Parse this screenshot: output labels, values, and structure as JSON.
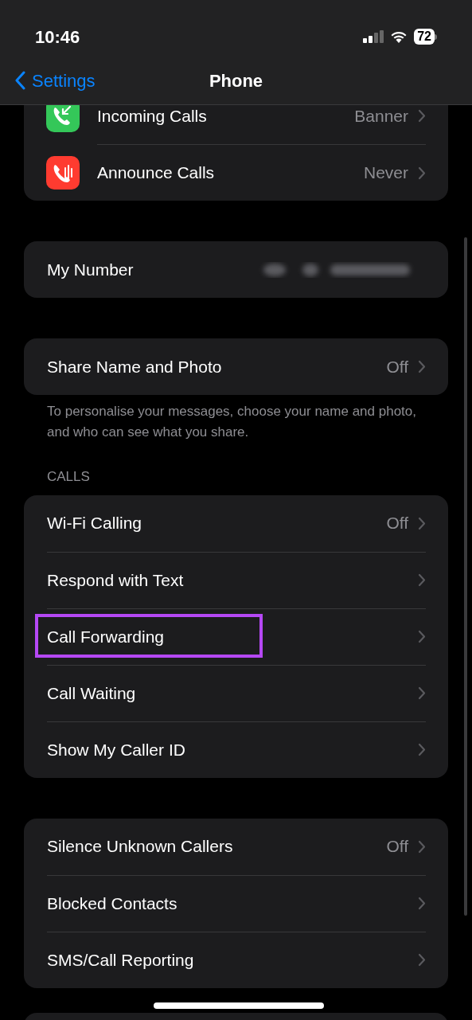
{
  "status_bar": {
    "time": "10:46",
    "battery": "72"
  },
  "nav": {
    "back": "Settings",
    "title": "Phone"
  },
  "groups": [
    {
      "rows": [
        {
          "kind": "icon",
          "label": "Incoming Calls",
          "value": "Banner",
          "color": "#34c759",
          "highlighted": false
        },
        {
          "kind": "icon",
          "label": "Announce Calls",
          "value": "Never",
          "color": "#ff3b30",
          "highlighted": false
        }
      ]
    },
    {
      "rows": [
        {
          "kind": "redacted",
          "label": "My Number",
          "highlighted": false
        }
      ]
    },
    {
      "rows": [
        {
          "kind": "plain",
          "label": "Share Name and Photo",
          "value": "Off",
          "highlighted": false
        }
      ],
      "footer": "To personalise your messages, choose your name and photo, and who can see what you share."
    },
    {
      "header": "CALLS",
      "rows": [
        {
          "kind": "plain",
          "label": "Wi-Fi Calling",
          "value": "Off",
          "highlighted": false
        },
        {
          "kind": "plain",
          "label": "Respond with Text",
          "highlighted": false
        },
        {
          "kind": "plain",
          "label": "Call Forwarding",
          "highlighted": true
        },
        {
          "kind": "plain",
          "label": "Call Waiting",
          "highlighted": false
        },
        {
          "kind": "plain",
          "label": "Show My Caller ID",
          "highlighted": false
        }
      ]
    },
    {
      "rows": [
        {
          "kind": "plain",
          "label": "Silence Unknown Callers",
          "value": "Off",
          "highlighted": false
        },
        {
          "kind": "plain",
          "label": "Blocked Contacts",
          "highlighted": false
        },
        {
          "kind": "plain",
          "label": "SMS/Call Reporting",
          "highlighted": false
        }
      ]
    }
  ]
}
